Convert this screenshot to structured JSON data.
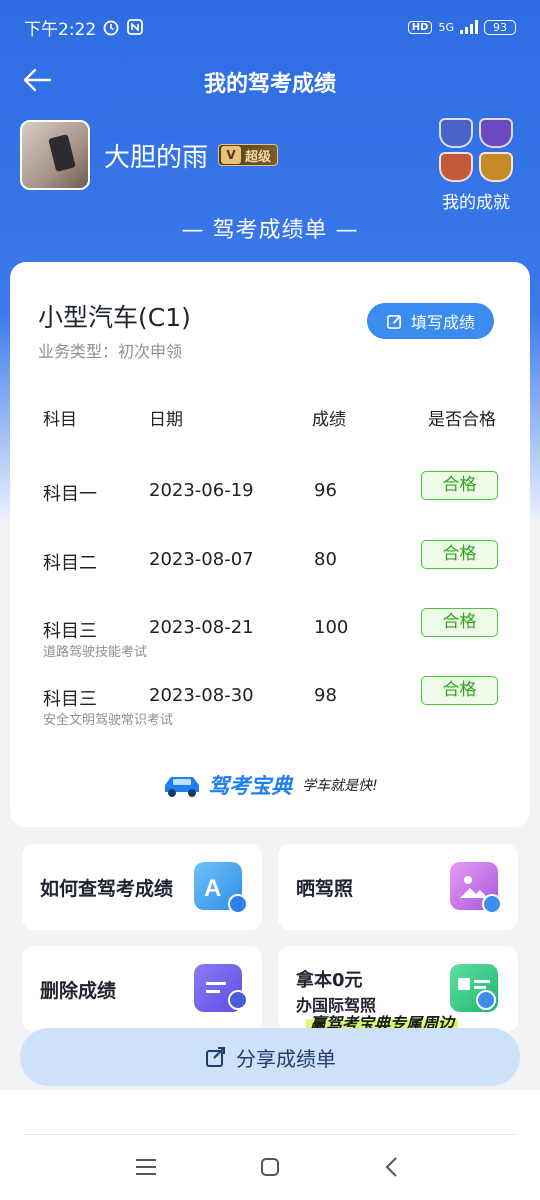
{
  "status_bar": {
    "time": "下午2:22",
    "hd": "HD",
    "net": "5G",
    "battery": "93"
  },
  "header": {
    "title": "我的驾考成绩"
  },
  "user": {
    "name": "大胆的雨",
    "vip_letter": "V",
    "vip_label": "超级"
  },
  "achievements": {
    "label": "我的成就",
    "badge_colors": [
      "#4a63c8",
      "#6a4bc4",
      "#c4583a",
      "#c48a2a"
    ]
  },
  "sheet_title": "— 驾考成绩单 —",
  "license": {
    "name": "小型汽车(C1)",
    "business_type": "业务类型：初次申领",
    "fill_button": "填写成绩"
  },
  "table": {
    "headers": [
      "科目",
      "日期",
      "成绩",
      "是否合格"
    ],
    "rows": [
      {
        "subject": "科目一",
        "date": "2023-06-19",
        "score": "96",
        "result": "合格",
        "note": ""
      },
      {
        "subject": "科目二",
        "date": "2023-08-07",
        "score": "80",
        "result": "合格",
        "note": ""
      },
      {
        "subject": "科目三",
        "date": "2023-08-21",
        "score": "100",
        "result": "合格",
        "note": "道路驾驶技能考试"
      },
      {
        "subject": "科目三",
        "date": "2023-08-30",
        "score": "98",
        "result": "合格",
        "note": "安全文明驾驶常识考试"
      }
    ]
  },
  "brand": {
    "name": "驾考宝典",
    "slogan": "学车就是快!"
  },
  "tiles": [
    {
      "title": "如何查驾考成绩",
      "icon": "search-doc-icon"
    },
    {
      "title": "晒驾照",
      "icon": "photo-icon"
    },
    {
      "title": "删除成绩",
      "icon": "delete-doc-icon"
    },
    {
      "title_line1": "拿本0元",
      "title_line2": "办国际驾照",
      "icon": "license-card-icon"
    }
  ],
  "promo": "赢驾考宝典专属周边",
  "share_button": "分享成绩单",
  "colors": {
    "primary": "#3b7aea",
    "accent": "#3b8cf0",
    "pass_green": "#4cc638"
  }
}
